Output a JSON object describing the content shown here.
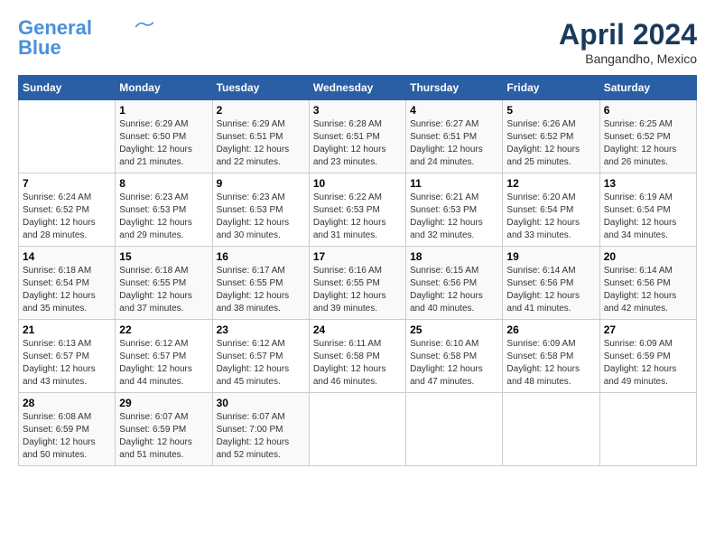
{
  "header": {
    "logo_line1": "General",
    "logo_line2": "Blue",
    "month": "April 2024",
    "location": "Bangandho, Mexico"
  },
  "weekdays": [
    "Sunday",
    "Monday",
    "Tuesday",
    "Wednesday",
    "Thursday",
    "Friday",
    "Saturday"
  ],
  "weeks": [
    [
      {
        "day": "",
        "info": ""
      },
      {
        "day": "1",
        "info": "Sunrise: 6:29 AM\nSunset: 6:50 PM\nDaylight: 12 hours\nand 21 minutes."
      },
      {
        "day": "2",
        "info": "Sunrise: 6:29 AM\nSunset: 6:51 PM\nDaylight: 12 hours\nand 22 minutes."
      },
      {
        "day": "3",
        "info": "Sunrise: 6:28 AM\nSunset: 6:51 PM\nDaylight: 12 hours\nand 23 minutes."
      },
      {
        "day": "4",
        "info": "Sunrise: 6:27 AM\nSunset: 6:51 PM\nDaylight: 12 hours\nand 24 minutes."
      },
      {
        "day": "5",
        "info": "Sunrise: 6:26 AM\nSunset: 6:52 PM\nDaylight: 12 hours\nand 25 minutes."
      },
      {
        "day": "6",
        "info": "Sunrise: 6:25 AM\nSunset: 6:52 PM\nDaylight: 12 hours\nand 26 minutes."
      }
    ],
    [
      {
        "day": "7",
        "info": "Sunrise: 6:24 AM\nSunset: 6:52 PM\nDaylight: 12 hours\nand 28 minutes."
      },
      {
        "day": "8",
        "info": "Sunrise: 6:23 AM\nSunset: 6:53 PM\nDaylight: 12 hours\nand 29 minutes."
      },
      {
        "day": "9",
        "info": "Sunrise: 6:23 AM\nSunset: 6:53 PM\nDaylight: 12 hours\nand 30 minutes."
      },
      {
        "day": "10",
        "info": "Sunrise: 6:22 AM\nSunset: 6:53 PM\nDaylight: 12 hours\nand 31 minutes."
      },
      {
        "day": "11",
        "info": "Sunrise: 6:21 AM\nSunset: 6:53 PM\nDaylight: 12 hours\nand 32 minutes."
      },
      {
        "day": "12",
        "info": "Sunrise: 6:20 AM\nSunset: 6:54 PM\nDaylight: 12 hours\nand 33 minutes."
      },
      {
        "day": "13",
        "info": "Sunrise: 6:19 AM\nSunset: 6:54 PM\nDaylight: 12 hours\nand 34 minutes."
      }
    ],
    [
      {
        "day": "14",
        "info": "Sunrise: 6:18 AM\nSunset: 6:54 PM\nDaylight: 12 hours\nand 35 minutes."
      },
      {
        "day": "15",
        "info": "Sunrise: 6:18 AM\nSunset: 6:55 PM\nDaylight: 12 hours\nand 37 minutes."
      },
      {
        "day": "16",
        "info": "Sunrise: 6:17 AM\nSunset: 6:55 PM\nDaylight: 12 hours\nand 38 minutes."
      },
      {
        "day": "17",
        "info": "Sunrise: 6:16 AM\nSunset: 6:55 PM\nDaylight: 12 hours\nand 39 minutes."
      },
      {
        "day": "18",
        "info": "Sunrise: 6:15 AM\nSunset: 6:56 PM\nDaylight: 12 hours\nand 40 minutes."
      },
      {
        "day": "19",
        "info": "Sunrise: 6:14 AM\nSunset: 6:56 PM\nDaylight: 12 hours\nand 41 minutes."
      },
      {
        "day": "20",
        "info": "Sunrise: 6:14 AM\nSunset: 6:56 PM\nDaylight: 12 hours\nand 42 minutes."
      }
    ],
    [
      {
        "day": "21",
        "info": "Sunrise: 6:13 AM\nSunset: 6:57 PM\nDaylight: 12 hours\nand 43 minutes."
      },
      {
        "day": "22",
        "info": "Sunrise: 6:12 AM\nSunset: 6:57 PM\nDaylight: 12 hours\nand 44 minutes."
      },
      {
        "day": "23",
        "info": "Sunrise: 6:12 AM\nSunset: 6:57 PM\nDaylight: 12 hours\nand 45 minutes."
      },
      {
        "day": "24",
        "info": "Sunrise: 6:11 AM\nSunset: 6:58 PM\nDaylight: 12 hours\nand 46 minutes."
      },
      {
        "day": "25",
        "info": "Sunrise: 6:10 AM\nSunset: 6:58 PM\nDaylight: 12 hours\nand 47 minutes."
      },
      {
        "day": "26",
        "info": "Sunrise: 6:09 AM\nSunset: 6:58 PM\nDaylight: 12 hours\nand 48 minutes."
      },
      {
        "day": "27",
        "info": "Sunrise: 6:09 AM\nSunset: 6:59 PM\nDaylight: 12 hours\nand 49 minutes."
      }
    ],
    [
      {
        "day": "28",
        "info": "Sunrise: 6:08 AM\nSunset: 6:59 PM\nDaylight: 12 hours\nand 50 minutes."
      },
      {
        "day": "29",
        "info": "Sunrise: 6:07 AM\nSunset: 6:59 PM\nDaylight: 12 hours\nand 51 minutes."
      },
      {
        "day": "30",
        "info": "Sunrise: 6:07 AM\nSunset: 7:00 PM\nDaylight: 12 hours\nand 52 minutes."
      },
      {
        "day": "",
        "info": ""
      },
      {
        "day": "",
        "info": ""
      },
      {
        "day": "",
        "info": ""
      },
      {
        "day": "",
        "info": ""
      }
    ]
  ]
}
